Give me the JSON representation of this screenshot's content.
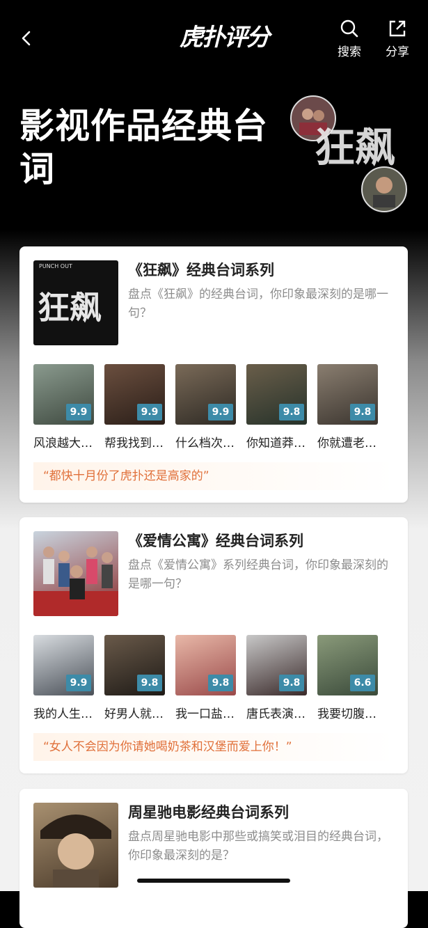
{
  "nav": {
    "logo": "虎扑评分",
    "search_label": "搜索",
    "share_label": "分享"
  },
  "hero": {
    "title": "影视作品经典台词",
    "art_text": "狂飙"
  },
  "series": [
    {
      "title": "《狂飙》经典台词系列",
      "desc": "盘点《狂飙》的经典台词，你印象最深刻的是哪一句？",
      "cover_text": "狂飙",
      "cover_subtext": "PUNCH OUT",
      "quote": "“都快十月份了虎扑还是高家的”",
      "items": [
        {
          "score": "9.9",
          "caption": "风浪越大…"
        },
        {
          "score": "9.9",
          "caption": "帮我找到…"
        },
        {
          "score": "9.9",
          "caption": "什么档次…"
        },
        {
          "score": "9.8",
          "caption": "你知道莽…"
        },
        {
          "score": "9.8",
          "caption": "你就遭老…"
        }
      ]
    },
    {
      "title": "《爱情公寓》经典台词系列",
      "desc": "盘点《爱情公寓》系列经典台词，你印象最深刻的是哪一句？",
      "quote": "“女人不会因为你请她喝奶茶和汉堡而爱上你！”",
      "items": [
        {
          "score": "9.9",
          "caption": "我的人生…"
        },
        {
          "score": "9.8",
          "caption": "好男人就…"
        },
        {
          "score": "9.8",
          "caption": "我一口盐…"
        },
        {
          "score": "9.8",
          "caption": "唐氏表演…"
        },
        {
          "score": "6.6",
          "caption": "我要切腹…"
        }
      ]
    },
    {
      "title": "周星驰电影经典台词系列",
      "desc": "盘点周星驰电影中那些或搞笑或泪目的经典台词，你印象最深刻的是？"
    }
  ],
  "colors": {
    "score_bg": "#3d8ba8",
    "quote_text": "#e0703a",
    "quote_bg": "#fff4ea"
  }
}
